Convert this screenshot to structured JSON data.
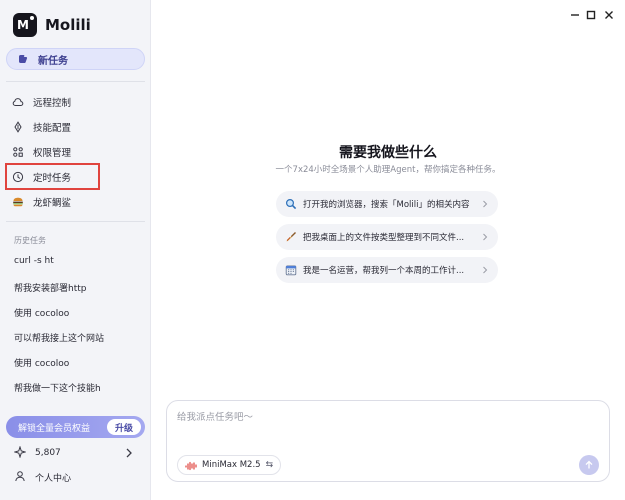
{
  "app": {
    "name": "Molili"
  },
  "sidebar": {
    "new_task": "新任务",
    "nav": [
      {
        "label": "远程控制",
        "icon": "cloud-icon"
      },
      {
        "label": "技能配置",
        "icon": "bolt-icon"
      },
      {
        "label": "权限管理",
        "icon": "grid-icon"
      },
      {
        "label": "定时任务",
        "icon": "clock-icon"
      },
      {
        "label": "龙虾鲷鲨",
        "icon": "burger-icon"
      }
    ],
    "history_title": "历史任务",
    "history": [
      "curl -s ht",
      "帮我安装部署http",
      "使用 cocoloo",
      "可以帮我接上这个网站",
      "使用 cocoloo",
      "帮我做一下这个技能h"
    ],
    "unlock": {
      "label": "解锁全量会员权益",
      "button": "升级"
    },
    "points": "5,807",
    "user_center": "个人中心"
  },
  "main": {
    "title": "需要我做些什么",
    "subtitle": "一个7x24小时全场景个人助理Agent，帮你搞定各种任务。",
    "suggestions": [
      {
        "label": "打开我的浏览器，搜索「Molili」的相关内容",
        "icon": "search-icon"
      },
      {
        "label": "把我桌面上的文件按类型整理到不同文件...",
        "icon": "broom-icon"
      },
      {
        "label": "我是一名运营，帮我列一个本周的工作计...",
        "icon": "calendar-icon"
      }
    ],
    "composer": {
      "placeholder": "给我派点任务吧〜",
      "model": "MiniMax M2.5",
      "swap_glyph": "⇆"
    }
  },
  "colors": {
    "accent": "#6b6fe0",
    "highlight": "#e0443e",
    "sidebar_bg": "#f3f4f8"
  }
}
